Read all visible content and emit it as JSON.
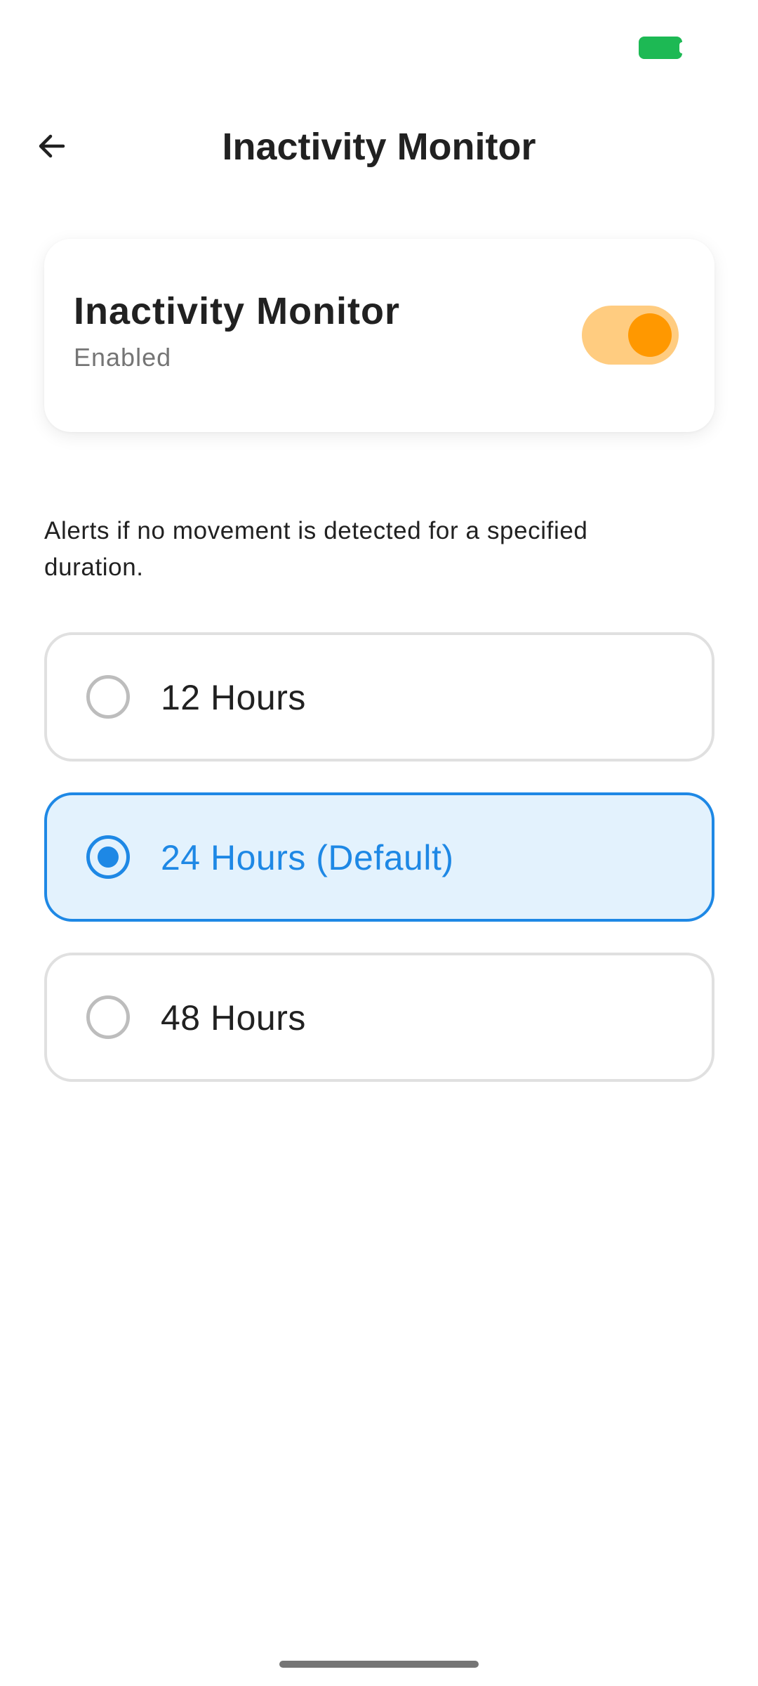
{
  "status_bar": {
    "battery_color": "#1db954"
  },
  "app_bar": {
    "title": "Inactivity Monitor",
    "back_icon": "arrow-left-icon"
  },
  "monitor_card": {
    "title": "Inactivity Monitor",
    "status": "Enabled",
    "toggle_on": true,
    "toggle_track_color": "#ffcc80",
    "toggle_thumb_color": "#ff9800"
  },
  "description": "Alerts if no movement is detected for a specified duration.",
  "options": [
    {
      "label": "12 Hours",
      "selected": false
    },
    {
      "label": "24 Hours (Default)",
      "selected": true
    },
    {
      "label": "48 Hours",
      "selected": false
    }
  ],
  "colors": {
    "accent": "#1e88e5",
    "selected_bg": "#e3f2fd",
    "border": "#e0e0e0"
  }
}
